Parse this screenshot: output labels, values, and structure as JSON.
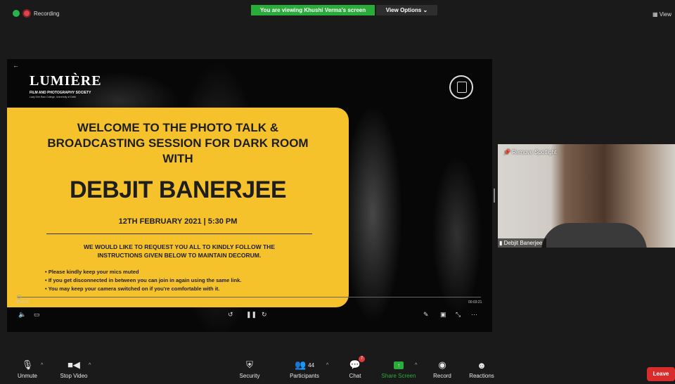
{
  "topbar": {
    "recording_label": "Recording",
    "viewing_banner": "You are viewing Khushi Verma's screen",
    "view_options": "View Options ⌄",
    "view_button": "View"
  },
  "slide": {
    "logo_text": "LUMIÈRE",
    "logo_sub": "FILM AND PHOTOGRAPHY SOCIETY",
    "logo_sub2": "Lady Shri Ram College, University of Delhi",
    "welcome_line1": "WELCOME TO THE PHOTO TALK &",
    "welcome_line2": "BROADCASTING SESSION FOR DARK ROOM",
    "welcome_line3": "WITH",
    "speaker": "DEBJIT BANERJEE",
    "date": "12TH FEBRUARY 2021 | 5:30 PM",
    "request_line1": "WE WOULD LIKE TO REQUEST YOU ALL TO KINDLY FOLLOW THE",
    "request_line2": "INSTRUCTIONS GIVEN BELOW TO MAINTAIN DECORUM.",
    "bullets": [
      "Please kindly keep your mics muted",
      "If you get disconnected in between you can join in again using the same link.",
      "You may keep your camera switched on if you're comfortable with it."
    ]
  },
  "player": {
    "time_elapsed": "00:00:01",
    "time_total": "00:03:21"
  },
  "side_video": {
    "spotlight_label": "Remove Spotlight",
    "participant_name": "Debjit Banerjee"
  },
  "toolbar": {
    "unmute": "Unmute",
    "stop_video": "Stop Video",
    "security": "Security",
    "participants": "Participants",
    "participant_count": "44",
    "chat": "Chat",
    "chat_badge": "7",
    "share_screen": "Share Screen",
    "record": "Record",
    "reactions": "Reactions",
    "leave": "Leave"
  },
  "colors": {
    "accent_green": "#2aac3b",
    "slide_yellow": "#f6c22c",
    "leave_red": "#d92d2d"
  }
}
